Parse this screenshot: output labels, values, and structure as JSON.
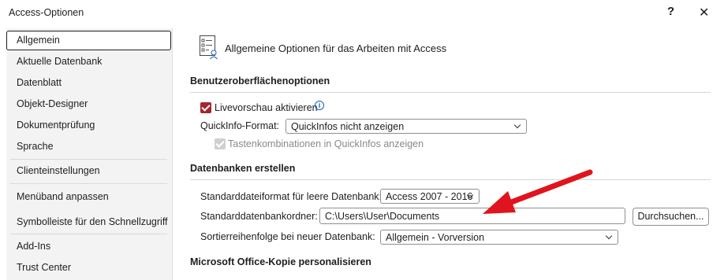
{
  "window": {
    "title": "Access-Optionen",
    "help_glyph": "?",
    "close_glyph": "✕"
  },
  "sidebar": {
    "items": [
      {
        "label": "Allgemein"
      },
      {
        "label": "Aktuelle Datenbank"
      },
      {
        "label": "Datenblatt"
      },
      {
        "label": "Objekt-Designer"
      },
      {
        "label": "Dokumentprüfung"
      },
      {
        "label": "Sprache"
      },
      {
        "label": "Clienteinstellungen"
      },
      {
        "label": "Menüband anpassen"
      },
      {
        "label": "Symbolleiste für den Schnellzugriff"
      },
      {
        "label": "Add-Ins"
      },
      {
        "label": "Trust Center"
      }
    ],
    "selected": "Allgemein"
  },
  "main": {
    "heading": "Allgemeine Optionen für das Arbeiten mit Access",
    "ui_section": {
      "title": "Benutzeroberflächenoptionen",
      "live_preview_label": "Livevorschau aktivieren",
      "live_preview_checked": true,
      "info_glyph": "i",
      "quickinfo_label": "QuickInfo-Format:",
      "quickinfo_value": "QuickInfos nicht anzeigen",
      "shortcuts_label": "Tastenkombinationen in QuickInfos anzeigen",
      "shortcuts_checked": true,
      "shortcuts_disabled": true
    },
    "db_section": {
      "title": "Datenbanken erstellen",
      "format_label": "Standarddateiformat für leere Datenbank:",
      "format_value": "Access 2007 - 2016",
      "folder_label": "Standarddatenbankordner:",
      "folder_value": "C:\\Users\\User\\Documents",
      "browse_label": "Durchsuchen...",
      "sort_label": "Sortierreihenfolge bei neuer Datenbank:",
      "sort_value": "Allgemein - Vorversion"
    },
    "office_section": {
      "title": "Microsoft Office-Kopie personalisieren"
    }
  },
  "colors": {
    "accent": "#a4262c",
    "arrow": "#e0141e",
    "info": "#1a5fb4"
  },
  "icons": {
    "heading": "options-settings-icon",
    "info": "info-icon"
  }
}
